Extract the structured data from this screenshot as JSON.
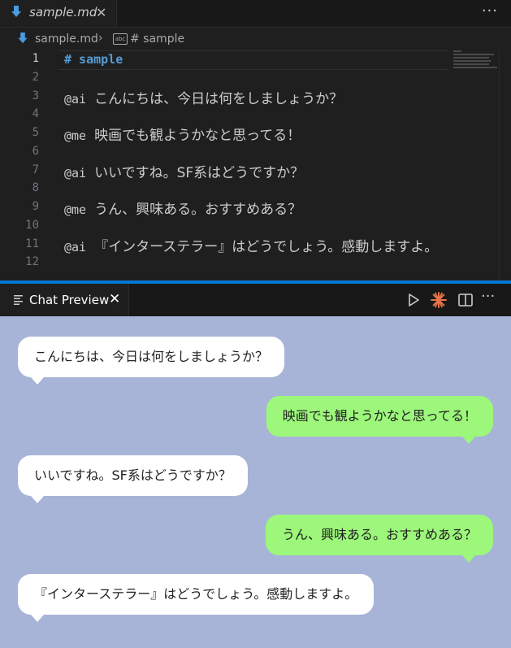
{
  "editor": {
    "tab": {
      "file_name": "sample.md",
      "close_glyph": "✕"
    },
    "more_glyph": "···",
    "breadcrumb": {
      "file": "sample.md",
      "separator": "›",
      "symbol_icon_text": "abc",
      "symbol": "# sample"
    },
    "line_numbers": [
      "1",
      "2",
      "3",
      "4",
      "5",
      "6",
      "7",
      "8",
      "9",
      "10",
      "11",
      "12"
    ],
    "lines": {
      "l1": "# sample",
      "l3_mention": "@ai",
      "l3_text": "こんにちは、今日は何をしましょうか？",
      "l5_mention": "@me",
      "l5_text": "映画でも観ようかなと思ってる！",
      "l7_mention": "@ai",
      "l7_text": "いいですね。SF系はどうですか？",
      "l9_mention": "@me",
      "l9_text": "うん、興味ある。おすすめある？",
      "l11_mention": "@ai",
      "l11_text": "『インターステラー』はどうでしょう。感動しますよ。"
    }
  },
  "panel": {
    "tab_label": "Chat Preview",
    "close_glyph": "✕",
    "tools": [
      "play-icon",
      "sparkle-icon",
      "split-editor-icon",
      "more-icon"
    ],
    "more_glyph": "···",
    "accent_color": "#0078d4",
    "sparkle_color": "#e8734a"
  },
  "chat": {
    "background": "#a7b4d8",
    "ai_bubble_color": "#ffffff",
    "me_bubble_color": "#9cf77a",
    "messages": [
      {
        "role": "ai",
        "text": "こんにちは、今日は何をしましょうか？"
      },
      {
        "role": "me",
        "text": "映画でも観ようかなと思ってる！"
      },
      {
        "role": "ai",
        "text": "いいですね。SF系はどうですか？"
      },
      {
        "role": "me",
        "text": "うん、興味ある。おすすめある？"
      },
      {
        "role": "ai",
        "text": "『インターステラー』はどうでしょう。感動しますよ。"
      }
    ]
  }
}
